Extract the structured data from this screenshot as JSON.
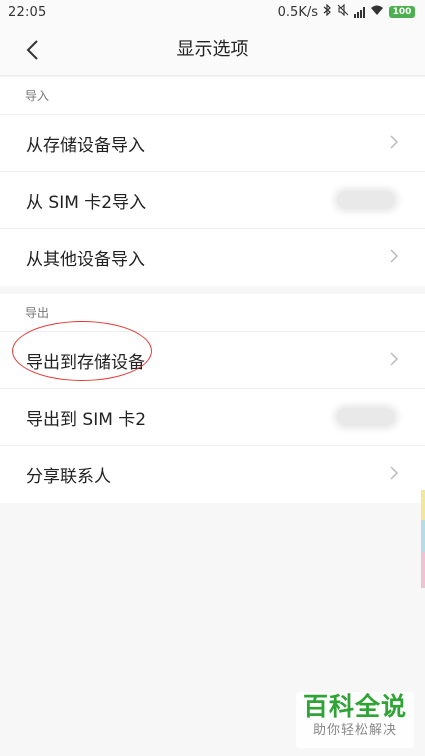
{
  "status_bar": {
    "time": "22:05",
    "net_speed": "0.5K/s",
    "battery": "100",
    "icons": [
      "bluetooth-icon",
      "mute-icon",
      "signal-icon",
      "wifi-icon",
      "battery-icon"
    ]
  },
  "header": {
    "back_icon": "chevron-left-icon",
    "title": "显示选项"
  },
  "import_section": {
    "label": "导入",
    "items": [
      {
        "label": "从存储设备导入",
        "accessory": "chevron"
      },
      {
        "label": "从 SIM 卡2导入",
        "accessory": "blurred"
      },
      {
        "label": "从其他设备导入",
        "accessory": "chevron"
      }
    ]
  },
  "export_section": {
    "label": "导出",
    "items": [
      {
        "label": "导出到存储设备",
        "accessory": "chevron",
        "highlighted": true
      },
      {
        "label": "导出到 SIM 卡2",
        "accessory": "blurred"
      },
      {
        "label": "分享联系人",
        "accessory": "chevron"
      }
    ]
  },
  "watermark": {
    "title": "百科全说",
    "subtitle": "助你轻松解决"
  },
  "colors": {
    "highlight_circle": "#e53935",
    "watermark_green": "#2fa336",
    "background": "#f7f7f7"
  }
}
